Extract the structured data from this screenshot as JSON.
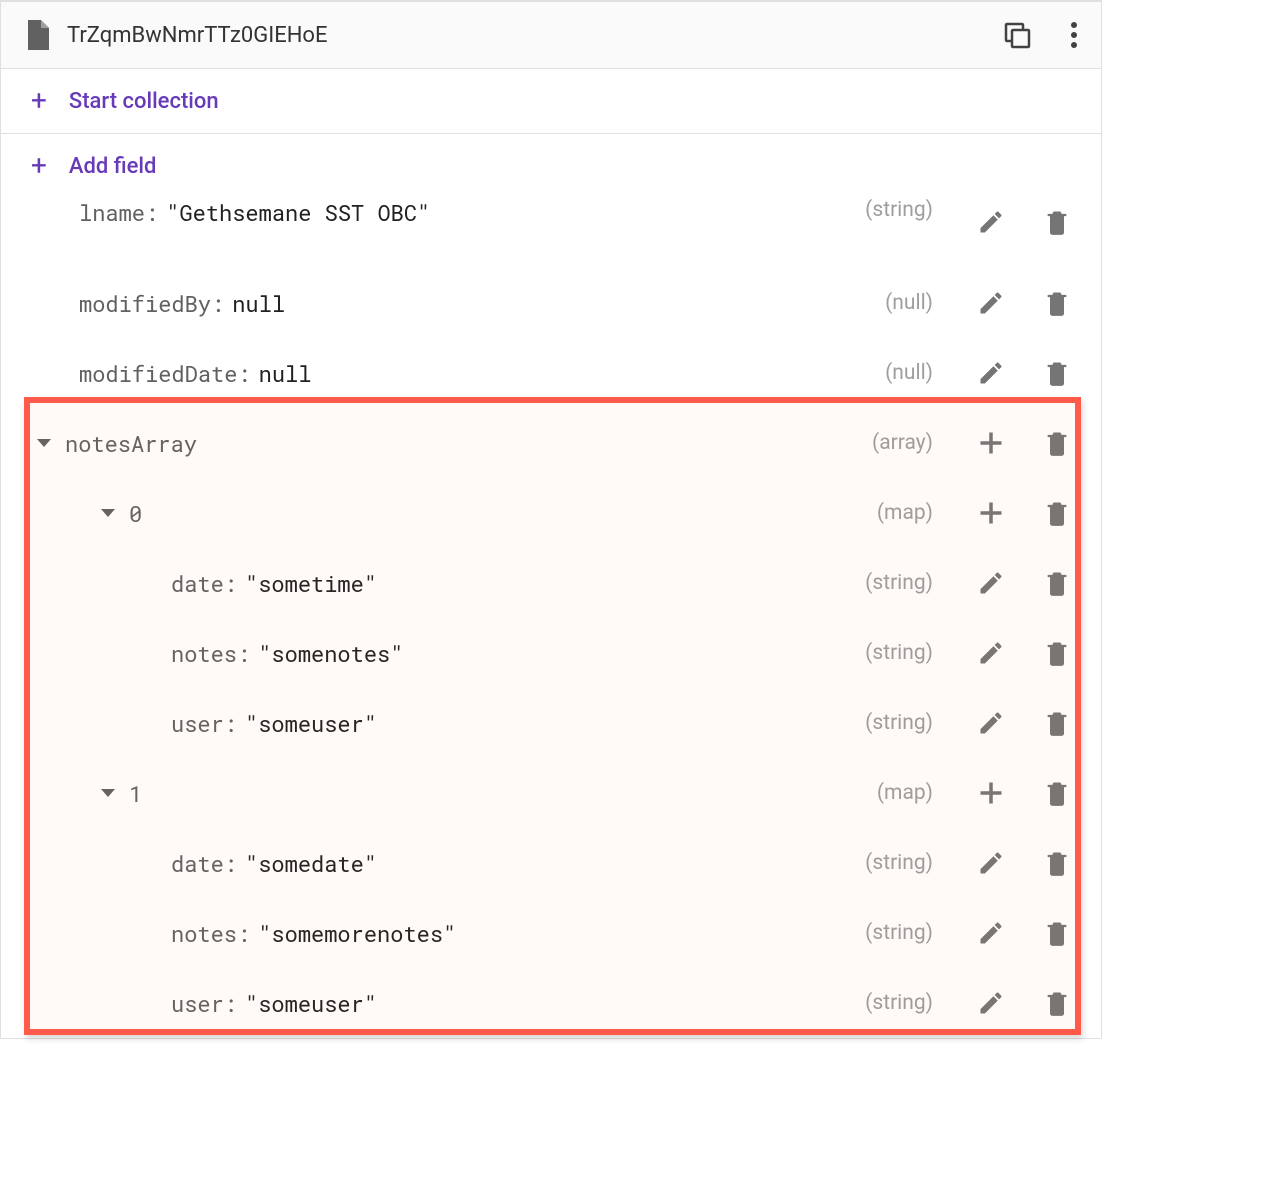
{
  "header": {
    "document_id": "TrZqmBwNmrTTz0GIEHoE"
  },
  "actions": {
    "start_collection": "Start collection",
    "add_field": "Add field"
  },
  "fields": [
    {
      "key": "lname",
      "value": "\"Gethsemane SST OBC\"",
      "type": "(string)",
      "indent": 1,
      "chevron": false,
      "action": "edit",
      "cutoff": true
    },
    {
      "key": "modifiedBy",
      "value": "null",
      "type": "(null)",
      "indent": 1,
      "chevron": false,
      "action": "edit"
    },
    {
      "key": "modifiedDate",
      "value": "null",
      "type": "(null)",
      "indent": 1,
      "chevron": false,
      "action": "edit"
    },
    {
      "key": "notesArray",
      "value": "",
      "type": "(array)",
      "indent": 0,
      "chevron": true,
      "action": "add"
    },
    {
      "key": "0",
      "value": "",
      "type": "(map)",
      "indent": 2,
      "chevron": true,
      "action": "add"
    },
    {
      "key": "date",
      "value": "\"sometime\"",
      "type": "(string)",
      "indent": 3,
      "chevron": false,
      "action": "edit"
    },
    {
      "key": "notes",
      "value": "\"somenotes\"",
      "type": "(string)",
      "indent": 3,
      "chevron": false,
      "action": "edit"
    },
    {
      "key": "user",
      "value": "\"someuser\"",
      "type": "(string)",
      "indent": 3,
      "chevron": false,
      "action": "edit"
    },
    {
      "key": "1",
      "value": "",
      "type": "(map)",
      "indent": 2,
      "chevron": true,
      "action": "add"
    },
    {
      "key": "date",
      "value": "\"somedate\"",
      "type": "(string)",
      "indent": 3,
      "chevron": false,
      "action": "edit"
    },
    {
      "key": "notes",
      "value": "\"somemorenotes\"",
      "type": "(string)",
      "indent": 3,
      "chevron": false,
      "action": "edit"
    },
    {
      "key": "user",
      "value": "\"someuser\"",
      "type": "(string)",
      "indent": 3,
      "chevron": false,
      "action": "edit"
    }
  ]
}
